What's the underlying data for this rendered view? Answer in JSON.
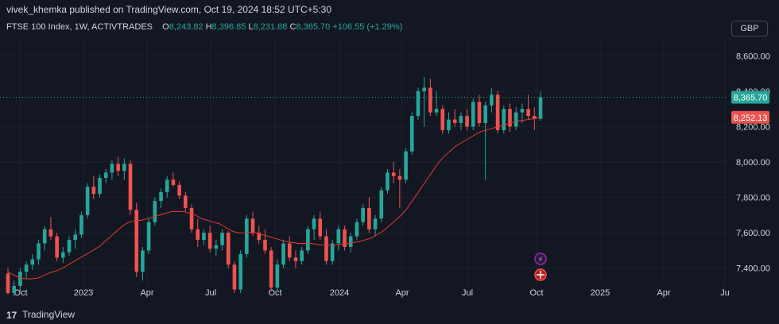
{
  "header": {
    "publisher": "vivek_khemka published on TradingView.com, Oct 19, 2024 18:52 UTC+5:30"
  },
  "legend": {
    "symbol": "FTSE 100 Index, 1W, ACTIVTRADES",
    "o_label": "O",
    "o": "8,243.82",
    "h_label": "H",
    "h": "8,396.85",
    "l_label": "L",
    "l": "8,231.88",
    "c_label": "C",
    "c": "8,365.70",
    "change": "+106.55 (+1.29%)"
  },
  "currency": "GBP",
  "footer": {
    "brand": "TradingView",
    "logo": "17"
  },
  "colors": {
    "up": "#26a69a",
    "down": "#ef5350",
    "ma": "#e53935",
    "bg": "#131722",
    "grid": "#1e222d",
    "text": "#d1d4dc"
  },
  "icons": {
    "lightning": "lightning-icon",
    "flag": "uk-flag-icon"
  },
  "chart_data": {
    "type": "candlestick",
    "symbol": "FTSE 100 Index",
    "interval": "1W",
    "ylim": [
      7300,
      8700
    ],
    "y_ticks": [
      "8,600.00",
      "8,400.00",
      "8,200.00",
      "8,000.00",
      "7,800.00",
      "7,600.00",
      "7,400.00"
    ],
    "x_ticks": [
      "Oct",
      "2023",
      "Apr",
      "Jul",
      "Oct",
      "2024",
      "Apr",
      "Jul",
      "Oct",
      "2025",
      "Apr",
      "Ju"
    ],
    "price_labels": [
      {
        "text": "8,365.70",
        "value": 8365.7,
        "color": "#26a69a"
      },
      {
        "text": "8,252.13",
        "value": 8252.13,
        "color": "#ef5350"
      }
    ],
    "candles": [
      {
        "o": 7370,
        "h": 7400,
        "l": 7250,
        "c": 7260
      },
      {
        "o": 7260,
        "h": 7330,
        "l": 7240,
        "c": 7300
      },
      {
        "o": 7300,
        "h": 7400,
        "l": 7270,
        "c": 7380
      },
      {
        "o": 7380,
        "h": 7440,
        "l": 7340,
        "c": 7420
      },
      {
        "o": 7420,
        "h": 7480,
        "l": 7390,
        "c": 7450
      },
      {
        "o": 7450,
        "h": 7560,
        "l": 7420,
        "c": 7540
      },
      {
        "o": 7540,
        "h": 7640,
        "l": 7500,
        "c": 7620
      },
      {
        "o": 7620,
        "h": 7690,
        "l": 7560,
        "c": 7580
      },
      {
        "o": 7580,
        "h": 7600,
        "l": 7440,
        "c": 7460
      },
      {
        "o": 7460,
        "h": 7520,
        "l": 7430,
        "c": 7490
      },
      {
        "o": 7490,
        "h": 7580,
        "l": 7470,
        "c": 7560
      },
      {
        "o": 7560,
        "h": 7620,
        "l": 7510,
        "c": 7590
      },
      {
        "o": 7590,
        "h": 7720,
        "l": 7570,
        "c": 7700
      },
      {
        "o": 7700,
        "h": 7880,
        "l": 7680,
        "c": 7860
      },
      {
        "o": 7860,
        "h": 7920,
        "l": 7790,
        "c": 7820
      },
      {
        "o": 7820,
        "h": 7930,
        "l": 7800,
        "c": 7910
      },
      {
        "o": 7910,
        "h": 7960,
        "l": 7880,
        "c": 7940
      },
      {
        "o": 7940,
        "h": 8010,
        "l": 7900,
        "c": 7990
      },
      {
        "o": 7990,
        "h": 8030,
        "l": 7920,
        "c": 7950
      },
      {
        "o": 7950,
        "h": 8020,
        "l": 7900,
        "c": 7990
      },
      {
        "o": 7990,
        "h": 8010,
        "l": 7700,
        "c": 7730
      },
      {
        "o": 7730,
        "h": 7770,
        "l": 7350,
        "c": 7380
      },
      {
        "o": 7380,
        "h": 7520,
        "l": 7330,
        "c": 7500
      },
      {
        "o": 7500,
        "h": 7680,
        "l": 7480,
        "c": 7660
      },
      {
        "o": 7660,
        "h": 7800,
        "l": 7640,
        "c": 7780
      },
      {
        "o": 7780,
        "h": 7850,
        "l": 7740,
        "c": 7830
      },
      {
        "o": 7830,
        "h": 7920,
        "l": 7800,
        "c": 7900
      },
      {
        "o": 7900,
        "h": 7940,
        "l": 7860,
        "c": 7870
      },
      {
        "o": 7870,
        "h": 7890,
        "l": 7790,
        "c": 7810
      },
      {
        "o": 7810,
        "h": 7830,
        "l": 7720,
        "c": 7740
      },
      {
        "o": 7740,
        "h": 7760,
        "l": 7600,
        "c": 7620
      },
      {
        "o": 7620,
        "h": 7680,
        "l": 7520,
        "c": 7560
      },
      {
        "o": 7560,
        "h": 7620,
        "l": 7530,
        "c": 7600
      },
      {
        "o": 7600,
        "h": 7640,
        "l": 7490,
        "c": 7510
      },
      {
        "o": 7510,
        "h": 7560,
        "l": 7470,
        "c": 7530
      },
      {
        "o": 7530,
        "h": 7620,
        "l": 7500,
        "c": 7600
      },
      {
        "o": 7600,
        "h": 7610,
        "l": 7400,
        "c": 7420
      },
      {
        "o": 7420,
        "h": 7440,
        "l": 7260,
        "c": 7280
      },
      {
        "o": 7280,
        "h": 7500,
        "l": 7260,
        "c": 7480
      },
      {
        "o": 7480,
        "h": 7700,
        "l": 7460,
        "c": 7680
      },
      {
        "o": 7680,
        "h": 7720,
        "l": 7580,
        "c": 7600
      },
      {
        "o": 7600,
        "h": 7640,
        "l": 7540,
        "c": 7560
      },
      {
        "o": 7560,
        "h": 7620,
        "l": 7480,
        "c": 7500
      },
      {
        "o": 7500,
        "h": 7520,
        "l": 7270,
        "c": 7290
      },
      {
        "o": 7290,
        "h": 7450,
        "l": 7270,
        "c": 7420
      },
      {
        "o": 7420,
        "h": 7560,
        "l": 7400,
        "c": 7540
      },
      {
        "o": 7540,
        "h": 7580,
        "l": 7440,
        "c": 7460
      },
      {
        "o": 7460,
        "h": 7500,
        "l": 7400,
        "c": 7440
      },
      {
        "o": 7440,
        "h": 7520,
        "l": 7420,
        "c": 7500
      },
      {
        "o": 7500,
        "h": 7640,
        "l": 7480,
        "c": 7620
      },
      {
        "o": 7620,
        "h": 7700,
        "l": 7560,
        "c": 7680
      },
      {
        "o": 7680,
        "h": 7720,
        "l": 7560,
        "c": 7580
      },
      {
        "o": 7580,
        "h": 7620,
        "l": 7420,
        "c": 7440
      },
      {
        "o": 7440,
        "h": 7560,
        "l": 7420,
        "c": 7540
      },
      {
        "o": 7540,
        "h": 7640,
        "l": 7500,
        "c": 7620
      },
      {
        "o": 7620,
        "h": 7640,
        "l": 7500,
        "c": 7520
      },
      {
        "o": 7520,
        "h": 7600,
        "l": 7490,
        "c": 7580
      },
      {
        "o": 7580,
        "h": 7680,
        "l": 7560,
        "c": 7660
      },
      {
        "o": 7660,
        "h": 7760,
        "l": 7640,
        "c": 7740
      },
      {
        "o": 7740,
        "h": 7800,
        "l": 7600,
        "c": 7620
      },
      {
        "o": 7620,
        "h": 7700,
        "l": 7580,
        "c": 7680
      },
      {
        "o": 7680,
        "h": 7860,
        "l": 7660,
        "c": 7840
      },
      {
        "o": 7840,
        "h": 7960,
        "l": 7820,
        "c": 7940
      },
      {
        "o": 7940,
        "h": 8000,
        "l": 7880,
        "c": 7920
      },
      {
        "o": 7920,
        "h": 7960,
        "l": 7740,
        "c": 7900
      },
      {
        "o": 7900,
        "h": 8080,
        "l": 7880,
        "c": 8060
      },
      {
        "o": 8060,
        "h": 8280,
        "l": 8040,
        "c": 8260
      },
      {
        "o": 8260,
        "h": 8420,
        "l": 8240,
        "c": 8400
      },
      {
        "o": 8400,
        "h": 8480,
        "l": 8200,
        "c": 8420
      },
      {
        "o": 8420,
        "h": 8470,
        "l": 8260,
        "c": 8280
      },
      {
        "o": 8280,
        "h": 8400,
        "l": 8260,
        "c": 8300
      },
      {
        "o": 8300,
        "h": 8320,
        "l": 8160,
        "c": 8180
      },
      {
        "o": 8180,
        "h": 8280,
        "l": 8160,
        "c": 8240
      },
      {
        "o": 8240,
        "h": 8300,
        "l": 8200,
        "c": 8220
      },
      {
        "o": 8220,
        "h": 8280,
        "l": 8180,
        "c": 8260
      },
      {
        "o": 8260,
        "h": 8300,
        "l": 8180,
        "c": 8200
      },
      {
        "o": 8200,
        "h": 8360,
        "l": 8180,
        "c": 8340
      },
      {
        "o": 8340,
        "h": 8380,
        "l": 8200,
        "c": 8220
      },
      {
        "o": 8220,
        "h": 8340,
        "l": 7900,
        "c": 8320
      },
      {
        "o": 8320,
        "h": 8420,
        "l": 8280,
        "c": 8380
      },
      {
        "o": 8380,
        "h": 8400,
        "l": 8160,
        "c": 8180
      },
      {
        "o": 8180,
        "h": 8320,
        "l": 8160,
        "c": 8300
      },
      {
        "o": 8300,
        "h": 8330,
        "l": 8170,
        "c": 8200
      },
      {
        "o": 8200,
        "h": 8310,
        "l": 8180,
        "c": 8280
      },
      {
        "o": 8280,
        "h": 8330,
        "l": 8220,
        "c": 8300
      },
      {
        "o": 8300,
        "h": 8380,
        "l": 8240,
        "c": 8260
      },
      {
        "o": 8260,
        "h": 8310,
        "l": 8180,
        "c": 8244
      },
      {
        "o": 8244,
        "h": 8397,
        "l": 8232,
        "c": 8366
      }
    ],
    "ma": [
      7380,
      7360,
      7345,
      7340,
      7340,
      7345,
      7360,
      7375,
      7385,
      7400,
      7420,
      7440,
      7460,
      7480,
      7500,
      7520,
      7550,
      7580,
      7610,
      7640,
      7660,
      7670,
      7670,
      7680,
      7690,
      7700,
      7710,
      7720,
      7720,
      7720,
      7710,
      7700,
      7680,
      7670,
      7660,
      7650,
      7630,
      7610,
      7600,
      7600,
      7600,
      7600,
      7590,
      7580,
      7570,
      7560,
      7550,
      7545,
      7540,
      7540,
      7540,
      7535,
      7530,
      7530,
      7530,
      7535,
      7540,
      7545,
      7550,
      7560,
      7570,
      7590,
      7610,
      7640,
      7670,
      7700,
      7740,
      7790,
      7840,
      7890,
      7940,
      7990,
      8030,
      8060,
      8090,
      8110,
      8130,
      8150,
      8170,
      8180,
      8190,
      8200,
      8210,
      8220,
      8230,
      8235,
      8240,
      8245,
      8250
    ]
  }
}
